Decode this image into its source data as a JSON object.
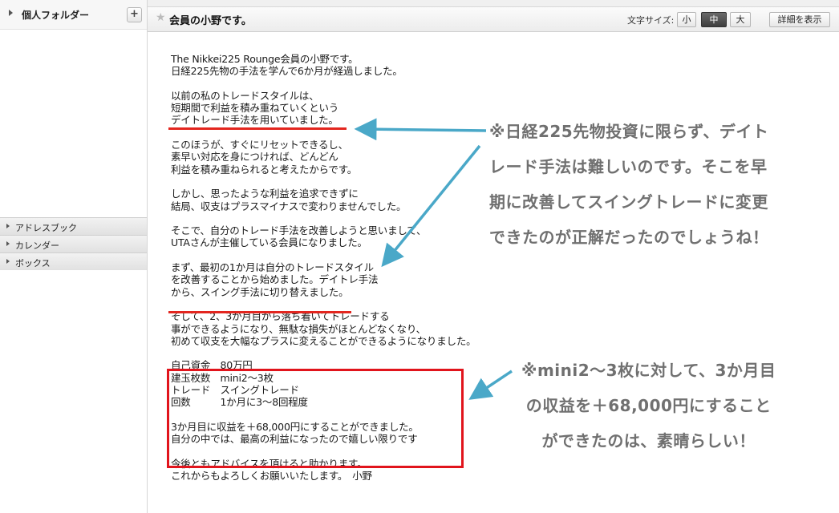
{
  "sidebar": {
    "personal_folder": "個人フォルダー",
    "add_symbol": "+",
    "sections": [
      "アドレスブック",
      "カレンダー",
      "ボックス"
    ]
  },
  "toolbar": {
    "subject": "会員の小野です。",
    "font_size_label": "文字サイズ:",
    "font_small": "小",
    "font_medium": "中",
    "font_large": "大",
    "detail_button": "詳細を表示"
  },
  "message": {
    "body": "The Nikkei225 Rounge会員の小野です。\n日経225先物の手法を学んで6か月が経過しました。\n\n以前の私のトレードスタイルは、\n短期間で利益を積み重ねていくという\nデイトレード手法を用いていました。\n\nこのほうが、すぐにリセットできるし、\n素早い対応を身につければ、どんどん\n利益を積み重ねられると考えたからです。\n\nしかし、思ったような利益を追求できずに\n結局、収支はプラスマイナスで変わりませんでした。\n\nそこで、自分のトレード手法を改善しようと思いまして、\nUTAさんが主催している会員になりました。\n\nまず、最初の1か月は自分のトレードスタイル\nを改善することから始めました。デイトレ手法\nから、スイング手法に切り替えました。\n\nそして、2、3か月目から落ち着いてトレードする\n事ができるようになり、無駄な損失がほとんどなくなり、\n初めて収支を大幅なプラスに変えることができるようになりました。\n\n自己資金　80万円\n建玉枚数　mini2〜3枚\nトレード　スイングトレード\n回数　　　1か月に3〜8回程度\n\n3か月目に収益を＋68,000円にすることができました。\n自分の中では、最高の利益になったので嬉しい限りです\n\n今後ともアドバイスを頂けると助かります。\nこれからもよろしくお願いいたします。　小野"
  },
  "annotations": {
    "note1": "※日経225先物投資に限らず、デイト\nレード手法は難しいのです。そこを早\n期に改善してスイングトレードに変更\nできたのが正解だったのでしょうね！",
    "note2": "※mini2〜3枚に対して、3か月目\nの収益を＋68,000円にすること\nができたのは、素晴らしい！"
  },
  "colors": {
    "highlight_red": "#e1141c",
    "arrow_blue": "#4aa8c8",
    "annotation_gray": "#707070"
  }
}
